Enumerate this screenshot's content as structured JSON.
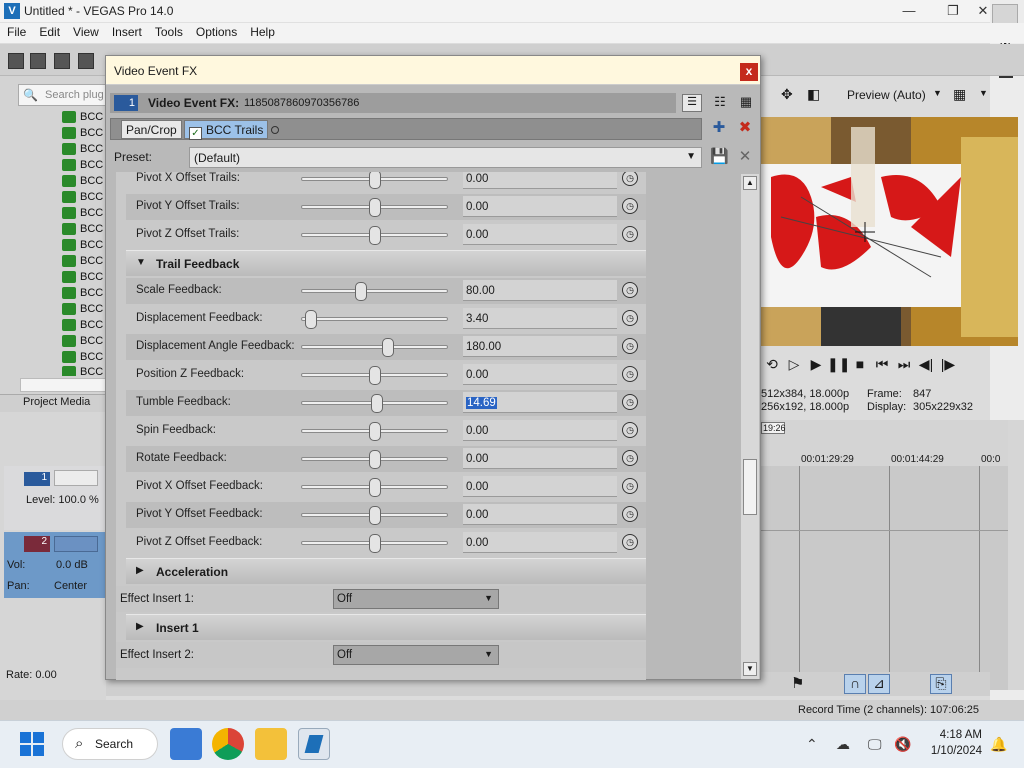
{
  "window": {
    "title": "Untitled * - VEGAS Pro 14.0",
    "app_icon": "vegas-logo-icon",
    "controls": [
      "minimize-icon",
      "maximize-icon",
      "close-icon"
    ]
  },
  "menu": {
    "items": [
      "File",
      "Edit",
      "View",
      "Insert",
      "Tools",
      "Options",
      "Help"
    ]
  },
  "left_panel": {
    "search_placeholder": "Search plug",
    "tree_items": [
      "BCC",
      "BCC",
      "BCC",
      "BCC",
      "BCC",
      "BCC",
      "BCC",
      "BCC",
      "BCC",
      "BCC",
      "BCC",
      "BCC",
      "BCC",
      "BCC",
      "BCC",
      "BCC",
      "BCC",
      "BCC"
    ],
    "tab": "Project Media"
  },
  "tracks": {
    "track1": {
      "num": "1",
      "level": "Level: 100.0 %"
    },
    "track2": {
      "num": "2",
      "vol_label": "Vol:",
      "vol_value": "0.0 dB",
      "pan_label": "Pan:",
      "pan_value": "Center"
    },
    "rate": "Rate: 0.00"
  },
  "fx_dialog": {
    "title": "Video Event FX",
    "close": "x",
    "header_num": "1",
    "header_label": "Video Event FX:",
    "header_id": "1185087860970356786",
    "chain": [
      {
        "label": "Pan/Crop",
        "active": false
      },
      {
        "label": "BCC Trails",
        "active": true
      }
    ],
    "preset_label": "Preset:",
    "preset_value": "(Default)",
    "params_top": [
      {
        "label": "Pivot X Offset Trails:",
        "value": "0.00",
        "pos": 0.5
      },
      {
        "label": "Pivot Y Offset Trails:",
        "value": "0.00",
        "pos": 0.5
      },
      {
        "label": "Pivot Z Offset Trails:",
        "value": "0.00",
        "pos": 0.5
      }
    ],
    "section_trail": "Trail Feedback",
    "params_feedback": [
      {
        "label": "Scale Feedback:",
        "value": "80.00",
        "pos": 0.4,
        "selected": false
      },
      {
        "label": "Displacement Feedback:",
        "value": "3.40",
        "pos": 0.03,
        "selected": false
      },
      {
        "label": "Displacement Angle Feedback:",
        "value": "180.00",
        "pos": 0.6,
        "selected": false
      },
      {
        "label": "Position Z Feedback:",
        "value": "0.00",
        "pos": 0.5,
        "selected": false
      },
      {
        "label": "Tumble Feedback:",
        "value": "14.69",
        "pos": 0.52,
        "selected": true
      },
      {
        "label": "Spin Feedback:",
        "value": "0.00",
        "pos": 0.5,
        "selected": false
      },
      {
        "label": "Rotate Feedback:",
        "value": "0.00",
        "pos": 0.5,
        "selected": false
      },
      {
        "label": "Pivot X Offset Feedback:",
        "value": "0.00",
        "pos": 0.5,
        "selected": false
      },
      {
        "label": "Pivot Y Offset Feedback:",
        "value": "0.00",
        "pos": 0.5,
        "selected": false
      },
      {
        "label": "Pivot Z Offset Feedback:",
        "value": "0.00",
        "pos": 0.5,
        "selected": false
      }
    ],
    "section_accel": "Acceleration",
    "effect_insert_1_label": "Effect Insert 1:",
    "effect_insert_1_value": "Off",
    "section_insert1": "Insert 1",
    "effect_insert_2_label": "Effect Insert 2:",
    "effect_insert_2_value": "Off"
  },
  "preview": {
    "mode": "Preview (Auto)",
    "project_label": "512x384, 18.000p",
    "preview_label": "256x192, 18.000p",
    "frame_label": "Frame:",
    "frame_value": "847",
    "display_label": "Display:",
    "display_value": "305x229x32"
  },
  "timeline": {
    "cursor_time": "19:26",
    "marks": [
      "00:01:29:29",
      "00:01:44:29",
      "00:0"
    ]
  },
  "status": {
    "record_time": "Record Time (2 channels): 107:06:25"
  },
  "taskbar": {
    "search": "Search",
    "time": "4:18 AM",
    "date": "1/10/2024"
  },
  "colors": {
    "accent": "#2a64c4",
    "dialog_title_bg": "#fff8de",
    "close_red": "#c42b1c",
    "track2_blue": "#6d99c8"
  }
}
